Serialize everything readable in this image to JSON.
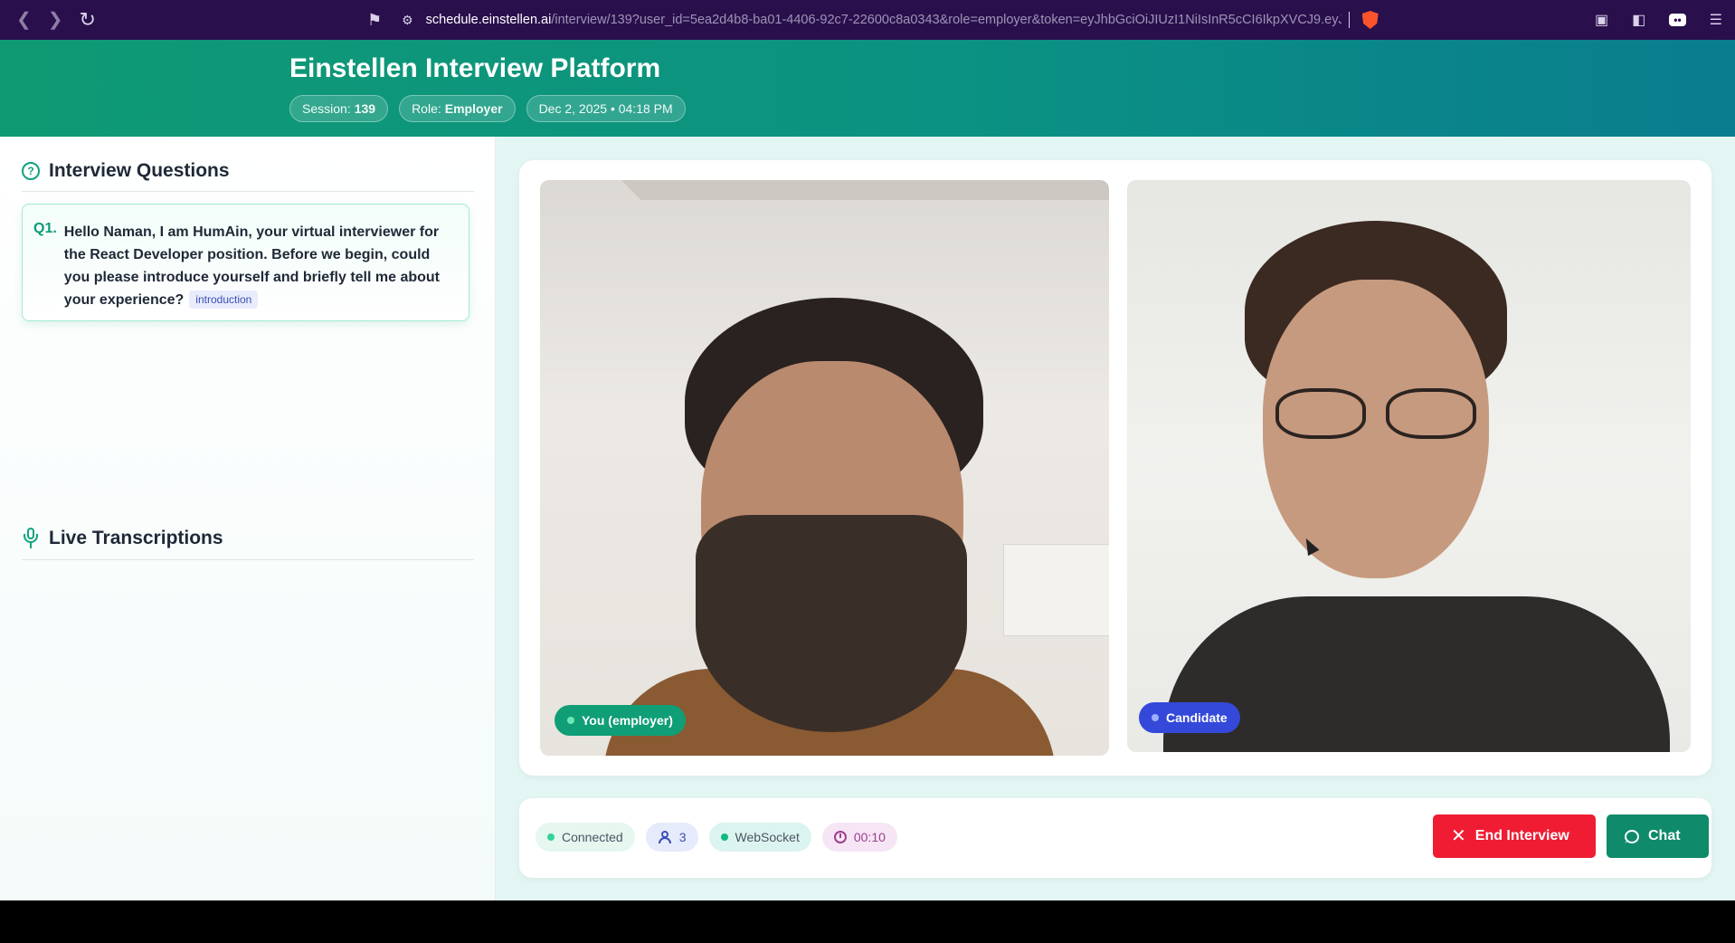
{
  "browser": {
    "url_host": "schedule.einstellen.ai",
    "url_path": "/interview/139?user_id=5ea2d4b8-ba01-4406-92c7-22600c8a0343&role=employer&token=eyJhbGciOiJIUzI1NiIsInR5cCI6IkpXVCJ9.eyJjb2..."
  },
  "header": {
    "title": "Einstellen Interview Platform",
    "session_label": "Session:",
    "session_value": "139",
    "role_label": "Role:",
    "role_value": "Employer",
    "datetime": "Dec 2, 2025 • 04:18 PM"
  },
  "questions": {
    "heading": "Interview Questions",
    "items": [
      {
        "number": "Q1.",
        "text": "Hello Naman, I am HumAin, your virtual interviewer for the React Developer position. Before we begin, could you please introduce yourself and briefly tell me about your experience?",
        "tag": "introduction"
      }
    ]
  },
  "transcriptions": {
    "heading": "Live Transcriptions"
  },
  "videos": {
    "self_label": "You (employer)",
    "remote_label": "Candidate"
  },
  "status": {
    "connection": "Connected",
    "participants": "3",
    "transport": "WebSocket",
    "elapsed": "00:10"
  },
  "actions": {
    "end_label": "End Interview",
    "chat_label": "Chat"
  },
  "colors": {
    "brand_green": "#0f9a74",
    "end_red": "#ef1c33",
    "chat_green": "#0f8a6a",
    "candidate_blue": "#3449d9"
  }
}
